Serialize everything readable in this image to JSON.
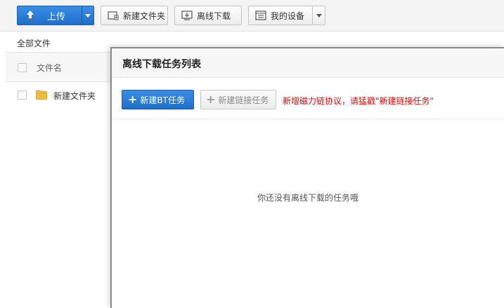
{
  "toolbar": {
    "upload_label": "上传",
    "new_folder_label": "新建文件夹",
    "offline_download_label": "离线下载",
    "my_device_label": "我的设备"
  },
  "breadcrumb": {
    "current": "全部文件"
  },
  "file_list": {
    "column_name": "文件名",
    "rows": [
      {
        "name": "新建文件夹",
        "type": "folder"
      }
    ]
  },
  "dialog": {
    "title": "离线下载任务列表",
    "new_bt_label": "新建BT任务",
    "new_link_label": "新建链接任务",
    "notice": "新增磁力链协议，请猛戳\"新建链接任务\"",
    "empty_message": "你还没有离线下载的任务哦"
  },
  "colors": {
    "primary_button": "#2a7fd9",
    "notice_text": "#cc1111",
    "folder": "#f5b93b"
  }
}
